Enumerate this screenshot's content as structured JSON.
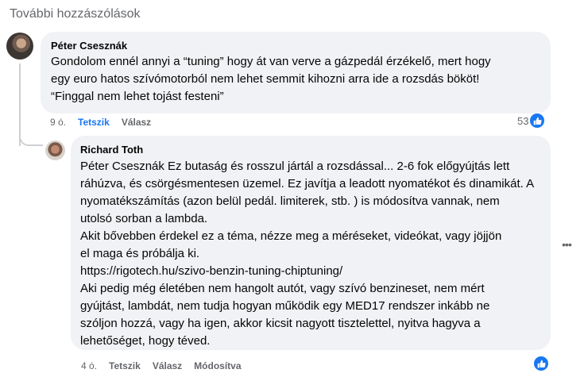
{
  "section_title": "További hozzászólások",
  "comments": [
    {
      "author": "Péter Csesznák",
      "text": "Gondolom ennél annyi a “tuning” hogy át van verve a gázpedál érzékelő, mert hogy\negy euro hatos szívómotorból nem lehet semmit kihozni arra ide a rozsdás bököt!\n“Finggal nem lehet tojást festeni”",
      "time": "9 ó.",
      "like_label": "Tetszik",
      "reply_label": "Válasz",
      "reaction_count": "53"
    },
    {
      "author": "Richard Toth",
      "text": "Péter Csesznák Ez butaság és rosszul jártál a rozsdással... 2-6 fok előgyújtás lett\nráhúzva, és csörgésmentesen üzemel. Ez javítja a leadott nyomatékot és dinamikát. A\nnyomatékszámítás (azon belül pedál. limiterek, stb. ) is módosítva vannak, nem\nutolsó sorban a lambda.\nAkit bővebben érdekel ez a téma, nézze meg a méréseket, videókat, vagy jöjjön\nel maga és próbálja ki.\nhttps://rigotech.hu/szivo-benzin-tuning-chiptuning/\nAki pedig még életében nem hangolt autót, vagy szívó benzineset, nem mért\ngyújtást, lambdát, nem tudja hogyan működik egy MED17 rendszer inkább ne\nszóljon hozzá, vagy ha igen, akkor kicsit nagyott tisztelettel, nyitva hagyva a\nlehetőséget, hogy téved.",
      "time": "4 ó.",
      "like_label": "Tetszik",
      "reply_label": "Válasz",
      "edit_label": "Módosítva"
    }
  ],
  "colors": {
    "accent": "#1877f2",
    "bubble": "#f0f2f5",
    "muted": "#65676b"
  },
  "icons": {
    "like": "thumbs-up-icon",
    "more": "more-horizontal-icon"
  }
}
